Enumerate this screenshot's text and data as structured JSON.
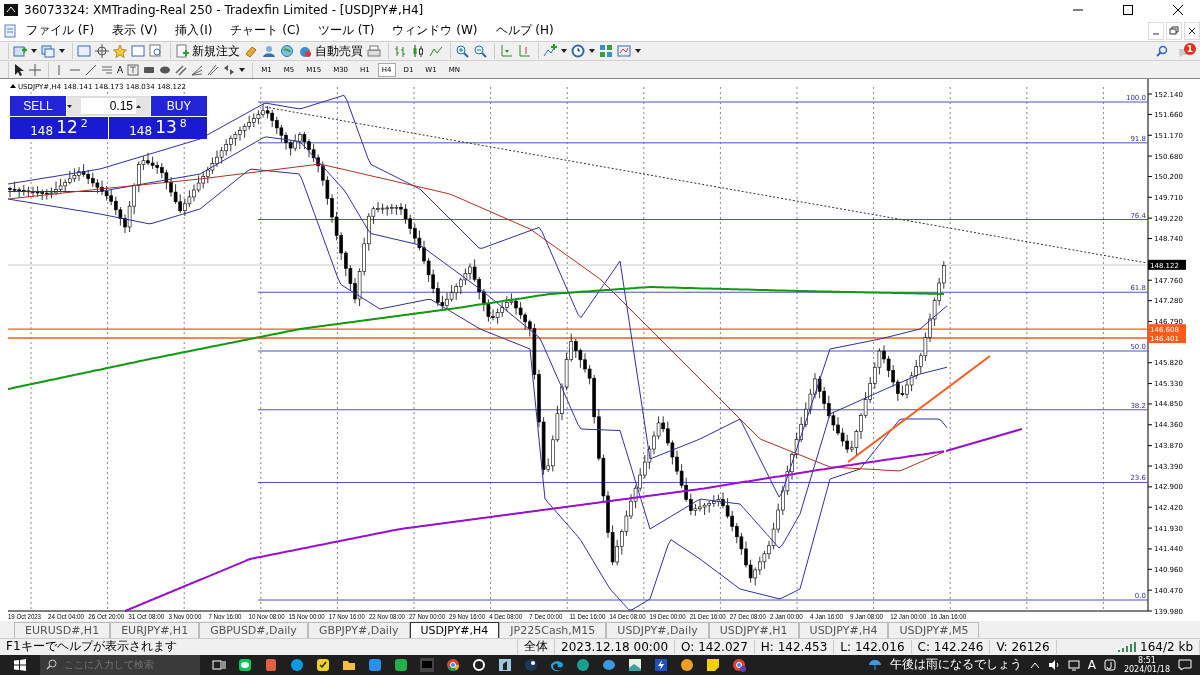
{
  "window": {
    "title": "36073324: XMTrading-Real 250 - Tradexfin Limited - [USDJPY#,H4]"
  },
  "menu": [
    "ファイル (F)",
    "表示 (V)",
    "挿入(I)",
    "チャート (C)",
    "ツール (T)",
    "ウィンドウ (W)",
    "ヘルプ (H)"
  ],
  "toolbar": {
    "new_order": "新規注文",
    "auto_trading": "自動売買",
    "notification_count": "1"
  },
  "drawing_tools": {
    "text_tool": "A"
  },
  "timeframes": [
    {
      "label": "M1",
      "selected": false
    },
    {
      "label": "M5",
      "selected": false
    },
    {
      "label": "M15",
      "selected": false
    },
    {
      "label": "M30",
      "selected": false
    },
    {
      "label": "H1",
      "selected": false
    },
    {
      "label": "H4",
      "selected": true
    },
    {
      "label": "D1",
      "selected": false
    },
    {
      "label": "W1",
      "selected": false
    },
    {
      "label": "MN",
      "selected": false
    }
  ],
  "chart": {
    "info": "USDJPY#,H4  148.141 148.173 148.034 148.122",
    "price_labels": [
      "152.140",
      "151.660",
      "151.170",
      "150.680",
      "150.200",
      "149.710",
      "149.220",
      "148.740",
      "147.760",
      "147.280",
      "146.790",
      "145.820",
      "145.330",
      "144.850",
      "144.360",
      "143.870",
      "143.390",
      "142.900",
      "142.420",
      "141.930",
      "141.440",
      "140.960",
      "140.470",
      "139.980"
    ],
    "marked_prices": [
      {
        "label": "148.122",
        "kind": "current"
      },
      {
        "label": "146.608",
        "kind": "line"
      },
      {
        "label": "146.401",
        "kind": "line"
      }
    ],
    "fib_levels": [
      "100.0",
      "91.8",
      "76.4",
      "61.8",
      "50.0",
      "38.2",
      "23.6",
      "0.0"
    ],
    "date_labels": [
      "19 Oct 2023",
      "24 Oct 04:00",
      "26 Oct 20:00",
      "31 Oct 08:00",
      "3 Nov 00:00",
      "7 Nov 16:00",
      "10 Nov 08:00",
      "15 Nov 00:00",
      "17 Nov 16:00",
      "22 Nov 08:00",
      "27 Nov 00:00",
      "29 Nov 16:00",
      "4 Dec 08:00",
      "7 Dec 00:00",
      "11 Dec 16:00",
      "14 Dec 08:00",
      "19 Dec 00:00",
      "21 Dec 16:00",
      "27 Dec 08:00",
      "2 Jan 00:00",
      "4 Jan 16:00",
      "9 Jan 08:00",
      "12 Jan 00:00",
      "16 Jan 16:00"
    ]
  },
  "trade_panel": {
    "sell": "SELL",
    "buy": "BUY",
    "lot": "0.15",
    "bid": {
      "big": "148",
      "mid": "12",
      "pip": "2"
    },
    "ask": {
      "big": "148",
      "mid": "13",
      "pip": "8"
    }
  },
  "chart_tabs": [
    {
      "label": "EURUSD#,H1",
      "selected": false
    },
    {
      "label": "EURJPY#,H1",
      "selected": false
    },
    {
      "label": "GBPUSD#,Daily",
      "selected": false
    },
    {
      "label": "GBPJPY#,Daily",
      "selected": false
    },
    {
      "label": "USDJPY#,H4",
      "selected": true
    },
    {
      "label": "JP225Cash,M15",
      "selected": false
    },
    {
      "label": "USDJPY#,Daily",
      "selected": false
    },
    {
      "label": "USDJPY#,H1",
      "selected": false
    },
    {
      "label": "USDJPY#,H4",
      "selected": false
    },
    {
      "label": "USDJPY#,M5",
      "selected": false
    }
  ],
  "status_bar": {
    "help": "F1キーでヘルプが表示されます",
    "profile": "全体",
    "time": "2023.12.18 00:00",
    "open": "O: 142.027",
    "high": "H: 142.453",
    "low": "L: 142.016",
    "close": "C: 142.246",
    "volume": "V: 26126",
    "traffic": "164/2 kb"
  },
  "taskbar": {
    "search_placeholder": "ここに入力して検索",
    "weather": "午後は雨になるでしょう",
    "ime": "A",
    "time": "8:51",
    "date": "2024/01/18"
  }
}
